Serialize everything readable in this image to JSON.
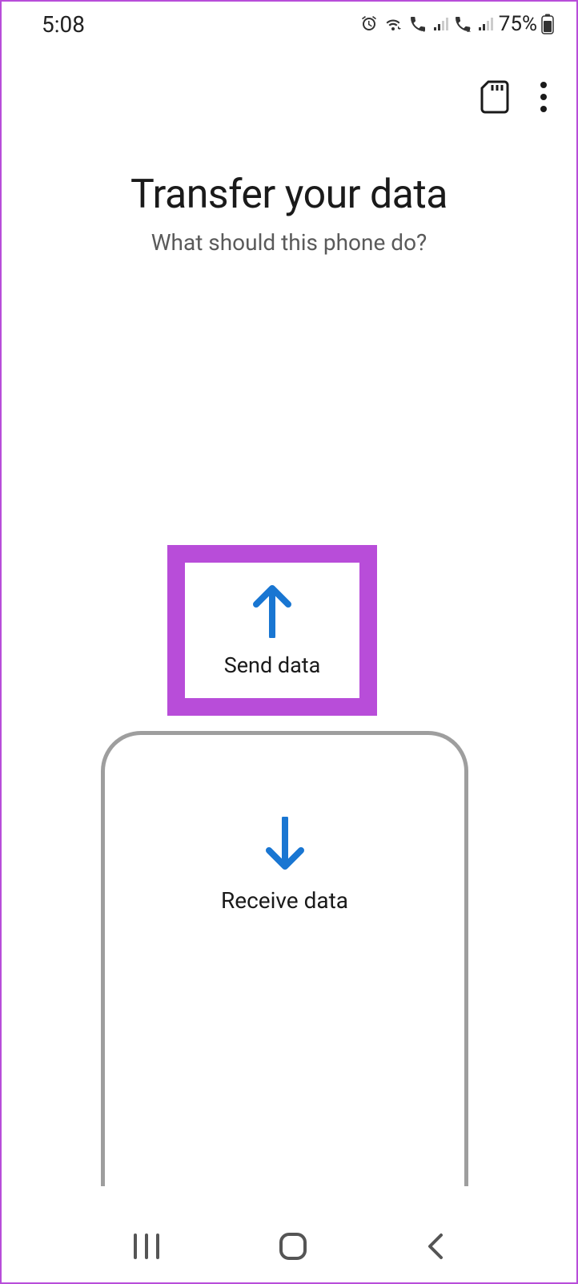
{
  "statusBar": {
    "time": "5:08",
    "batteryText": "75%"
  },
  "header": {
    "title": "Transfer your data",
    "subtitle": "What should this phone do?"
  },
  "actions": {
    "sendLabel": "Send data",
    "receiveLabel": "Receive data"
  },
  "colors": {
    "highlight": "#b84dd9",
    "arrow": "#1976d2",
    "border": "#9e9e9e"
  }
}
